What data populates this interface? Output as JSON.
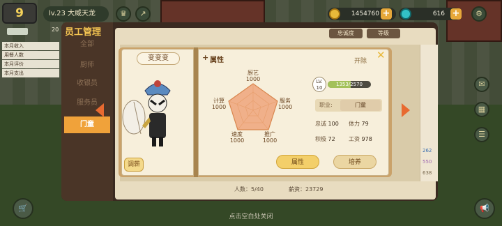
{
  "hud": {
    "level": "9",
    "player": "lv.23 大威天龙",
    "coins": "1454760",
    "gems": "616"
  },
  "left_stats": [
    "本月收入",
    "用餐人数",
    "本月评价",
    "本月支出"
  ],
  "left_partial_num": "20",
  "staff_window": {
    "title": "员工管理",
    "side_items": [
      "全部",
      "厨师",
      "收银员",
      "服务员",
      "门童"
    ],
    "active_index": 4,
    "sort_tabs": [
      "忠诚度",
      "等级"
    ],
    "count": "人数：5/40",
    "salary": "薪资：23729",
    "side_peek_values": [
      "262",
      "550",
      "638"
    ]
  },
  "detail": {
    "name": "变变变",
    "adjust_label": "调薪",
    "attr_header": "属性",
    "dismiss_label": "开除",
    "pentagon": [
      {
        "name": "厨艺",
        "value": 1000
      },
      {
        "name": "服务",
        "value": 1000
      },
      {
        "name": "推广",
        "value": 1000
      },
      {
        "name": "速度",
        "value": 1000
      },
      {
        "name": "计算",
        "value": 1000
      }
    ],
    "lv_label": "LV.",
    "lv": "10",
    "exp_text": "1353/2570",
    "exp_current": 1353,
    "exp_max": 2570,
    "job_label": "职业:",
    "job": "门童",
    "loyalty_label": "忠诚",
    "loyalty": "100",
    "stamina_label": "体力",
    "stamina": "79",
    "positive_label": "积极",
    "positive": "72",
    "wage_label": "工资",
    "wage": "978",
    "btn_attr": "属性",
    "btn_train": "培养"
  },
  "close_hint": "点击空白处关闭",
  "colors": {
    "accent": "#f0a23a",
    "gold": "#e8b93a",
    "radar": "#f0b08a"
  }
}
